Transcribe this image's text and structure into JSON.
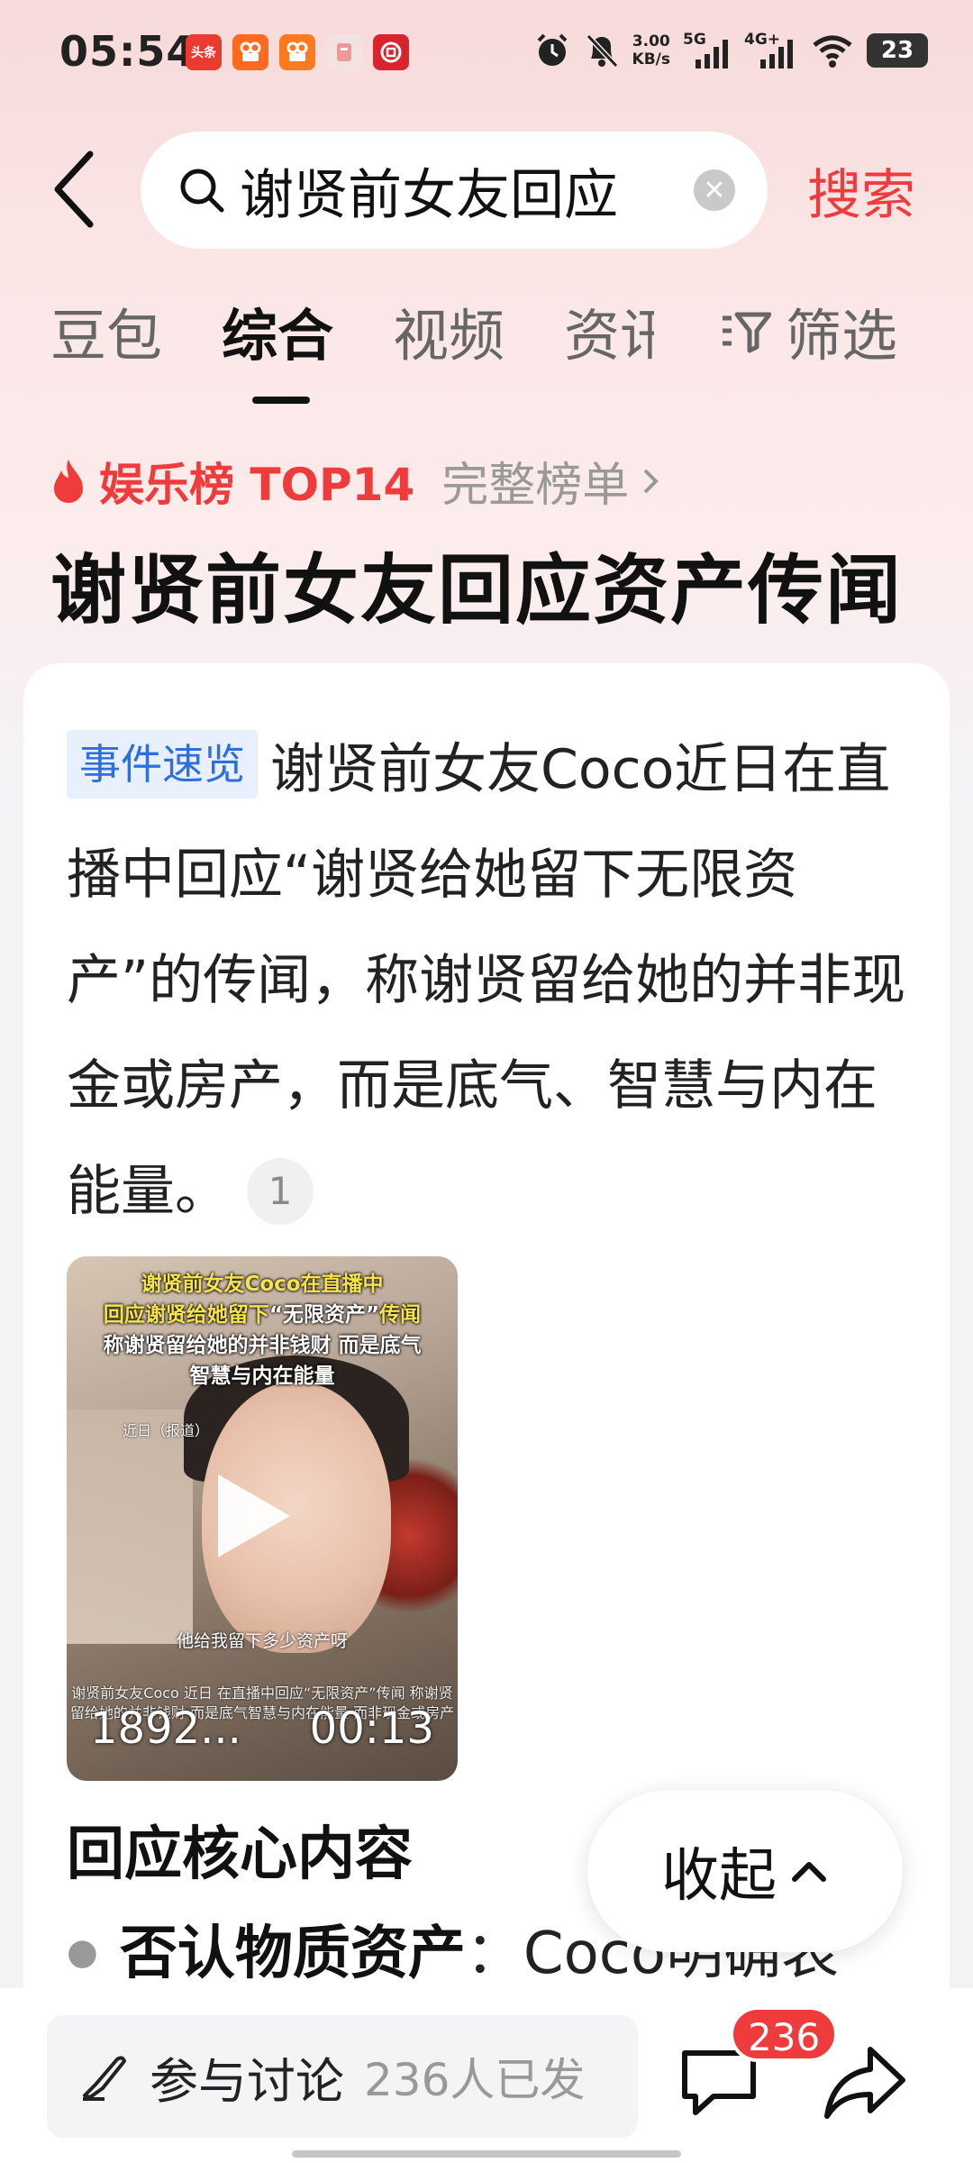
{
  "status_bar": {
    "time": "05:54",
    "notifications": [
      "头条",
      "快手",
      "快手极速版",
      "社区",
      "银行"
    ],
    "network_speed": "3.00",
    "network_unit": "KB/s",
    "signal1": "5G",
    "signal2": "4G+",
    "battery": "23"
  },
  "search": {
    "query": "谢贤前女友回应",
    "search_button": "搜索"
  },
  "tabs": [
    "豆包",
    "综合",
    "视频",
    "资讯"
  ],
  "active_tab": "综合",
  "filter_label": "筛选",
  "ranking": {
    "label": "娱乐榜 TOP14",
    "full_list": "完整榜单"
  },
  "headline": "谢贤前女友回应资产传闻",
  "card": {
    "tag": "事件速览",
    "summary": "谢贤前女友Coco近日在直播中回应“谢贤给她留下无限资产”的传闻，称谢贤留给她的并非现金或房产，而是底气、智慧与内在能量。",
    "ref": "1",
    "video": {
      "title_line1": "谢贤前女友Coco在直播中",
      "title_line2_a": "回应谢贤给她留下",
      "title_line2_b": "“无限资产”",
      "title_line2_c": "传闻",
      "title_line3": "称谢贤留给她的并非钱财 而是底气",
      "title_line4": "智慧与内在能量",
      "date_tag": "近日（报道）",
      "subtitle": "他给我留下多少资产呀",
      "caption": "谢贤前女友Coco 近日 在直播中回应“无限资产”传闻 称谢贤留给她的并非钱财 而是底气智慧与内在能量 而非现金或房产",
      "views": "1892...",
      "duration": "00:13"
    },
    "section_title": "回应核心内容",
    "bullet_bold": "否认物质资产",
    "bullet_rest": "：Coco明确表"
  },
  "collapse": "收起",
  "bottom": {
    "discuss_label": "参与讨论",
    "discuss_count": "236人已发",
    "comment_count": "236"
  },
  "colors": {
    "accent": "#ef3b3b",
    "tag_bg": "#e7f0fc",
    "tag_text": "#2d6ee0"
  }
}
